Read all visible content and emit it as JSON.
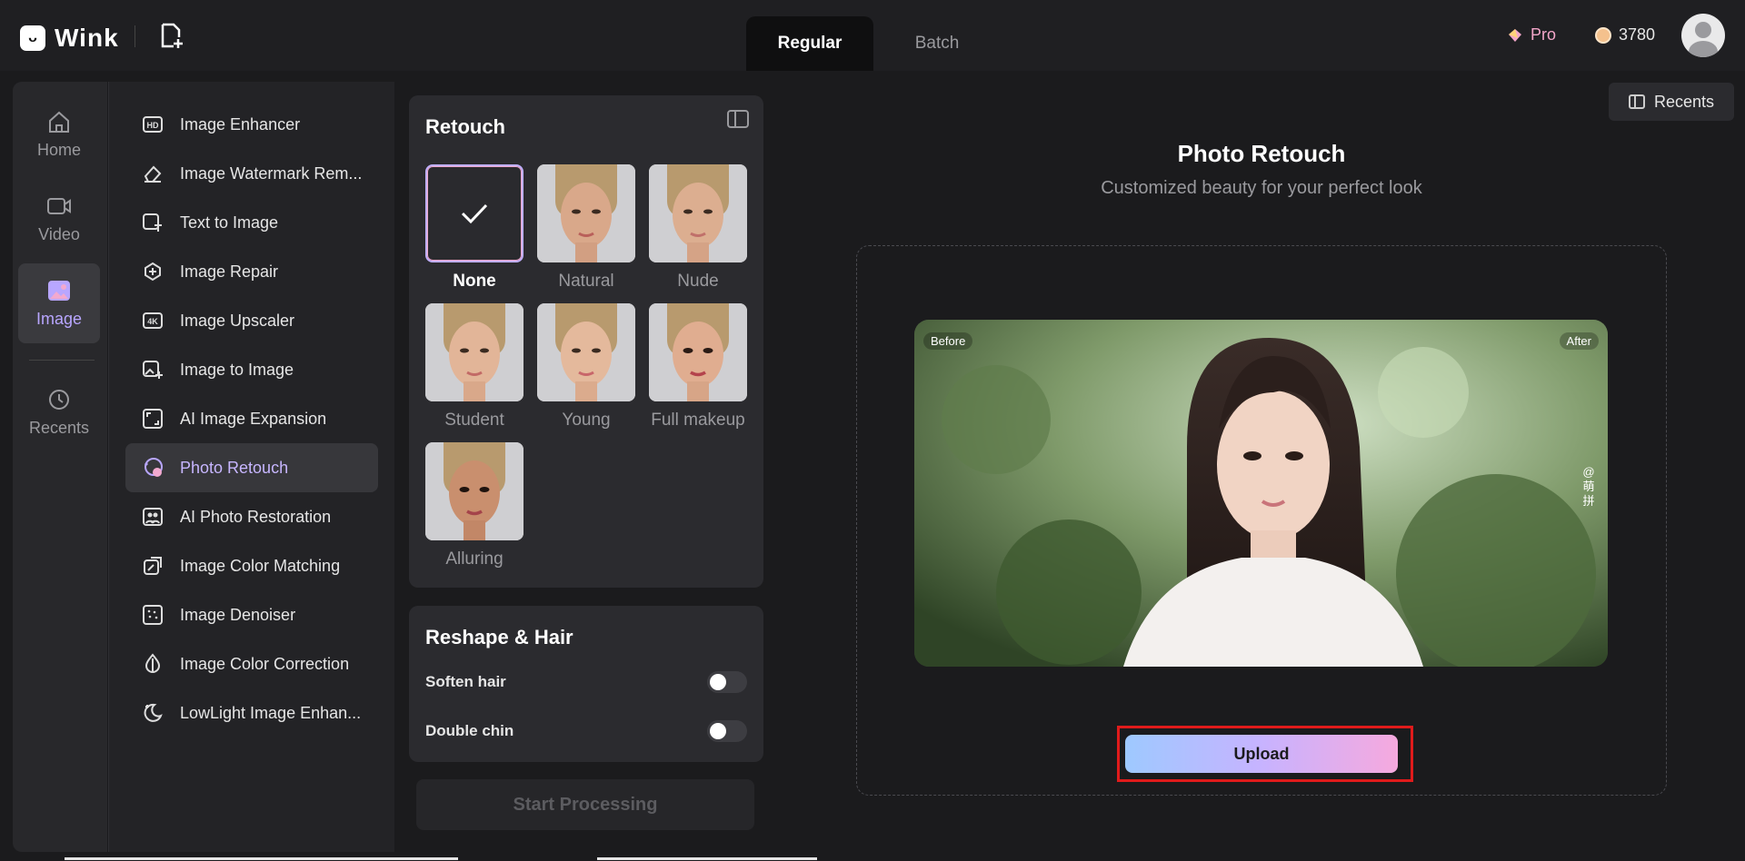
{
  "app": {
    "name": "Wink"
  },
  "header": {
    "tabs": [
      {
        "label": "Regular",
        "active": true
      },
      {
        "label": "Batch",
        "active": false
      }
    ],
    "pro_label": "Pro",
    "coins": "3780"
  },
  "leftnav": {
    "items": [
      {
        "label": "Home",
        "icon": "home-icon"
      },
      {
        "label": "Video",
        "icon": "video-icon"
      },
      {
        "label": "Image",
        "icon": "image-icon",
        "active": true
      },
      {
        "label": "Recents",
        "icon": "history-icon"
      }
    ]
  },
  "tools": {
    "items": [
      {
        "label": "Image Enhancer",
        "icon": "hd-icon"
      },
      {
        "label": "Image Watermark Rem...",
        "icon": "eraser-icon"
      },
      {
        "label": "Text to Image",
        "icon": "text-image-icon"
      },
      {
        "label": "Image Repair",
        "icon": "repair-icon"
      },
      {
        "label": "Image Upscaler",
        "icon": "4k-icon"
      },
      {
        "label": "Image to Image",
        "icon": "image-plus-icon"
      },
      {
        "label": "AI Image Expansion",
        "icon": "expand-icon"
      },
      {
        "label": "Photo Retouch",
        "icon": "retouch-icon",
        "active": true
      },
      {
        "label": "AI Photo Restoration",
        "icon": "restore-icon"
      },
      {
        "label": "Image Color Matching",
        "icon": "color-match-icon"
      },
      {
        "label": "Image Denoiser",
        "icon": "denoise-icon"
      },
      {
        "label": "Image Color Correction",
        "icon": "color-correct-icon"
      },
      {
        "label": "LowLight Image Enhan...",
        "icon": "lowlight-icon"
      }
    ]
  },
  "retouch": {
    "title": "Retouch",
    "styles": [
      {
        "label": "None",
        "selected": true
      },
      {
        "label": "Natural"
      },
      {
        "label": "Nude"
      },
      {
        "label": "Student"
      },
      {
        "label": "Young"
      },
      {
        "label": "Full makeup"
      },
      {
        "label": "Alluring"
      }
    ]
  },
  "reshape": {
    "title": "Reshape & Hair",
    "options": [
      {
        "label": "Soften hair",
        "on": false
      },
      {
        "label": "Double chin",
        "on": false
      }
    ]
  },
  "actions": {
    "start_processing": "Start Processing",
    "recents": "Recents",
    "upload": "Upload"
  },
  "main": {
    "title": "Photo Retouch",
    "subtitle": "Customized beauty for your perfect look",
    "before_label": "Before",
    "after_label": "After",
    "watermark": "@\n萌\n拼"
  },
  "colors": {
    "accent": "#c7b6ff",
    "pro": "#f3a6c9",
    "highlight_frame": "#e01b1b"
  }
}
